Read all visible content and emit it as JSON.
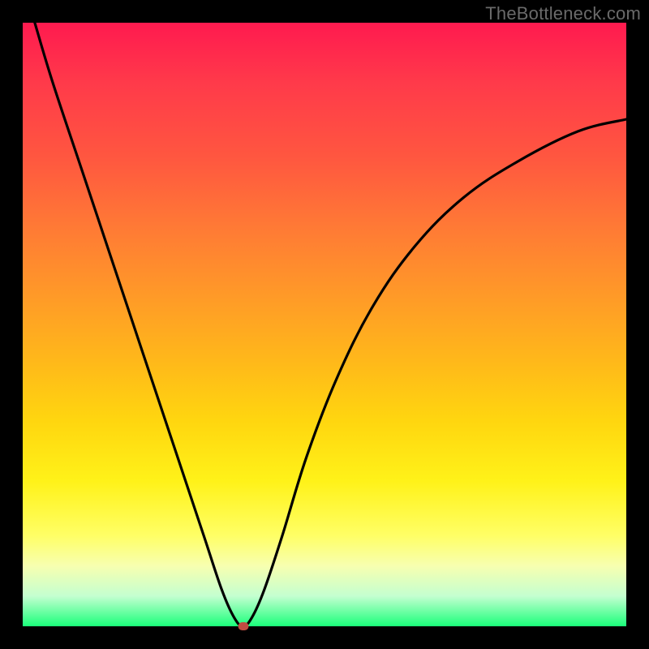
{
  "watermark": "TheBottleneck.com",
  "chart_data": {
    "type": "line",
    "title": "",
    "xlabel": "",
    "ylabel": "",
    "xlim": [
      0,
      100
    ],
    "ylim": [
      0,
      100
    ],
    "grid": false,
    "legend": false,
    "series": [
      {
        "name": "curve",
        "color": "#000000",
        "x": [
          2,
          5,
          10,
          15,
          20,
          25,
          30,
          33,
          35,
          36.5,
          38,
          40,
          43,
          47,
          52,
          58,
          65,
          73,
          82,
          92,
          100
        ],
        "values": [
          100,
          90,
          75,
          60,
          45,
          30,
          15,
          6,
          1.5,
          0,
          1.5,
          6,
          15,
          28,
          41,
          53,
          63,
          71,
          77,
          82,
          84
        ]
      }
    ],
    "marker": {
      "x": 36.5,
      "y": 0,
      "color": "#c04c42"
    },
    "background_gradient": {
      "top": "#ff1a4f",
      "mid": "#ffd60f",
      "bottom": "#1aff7a"
    }
  }
}
